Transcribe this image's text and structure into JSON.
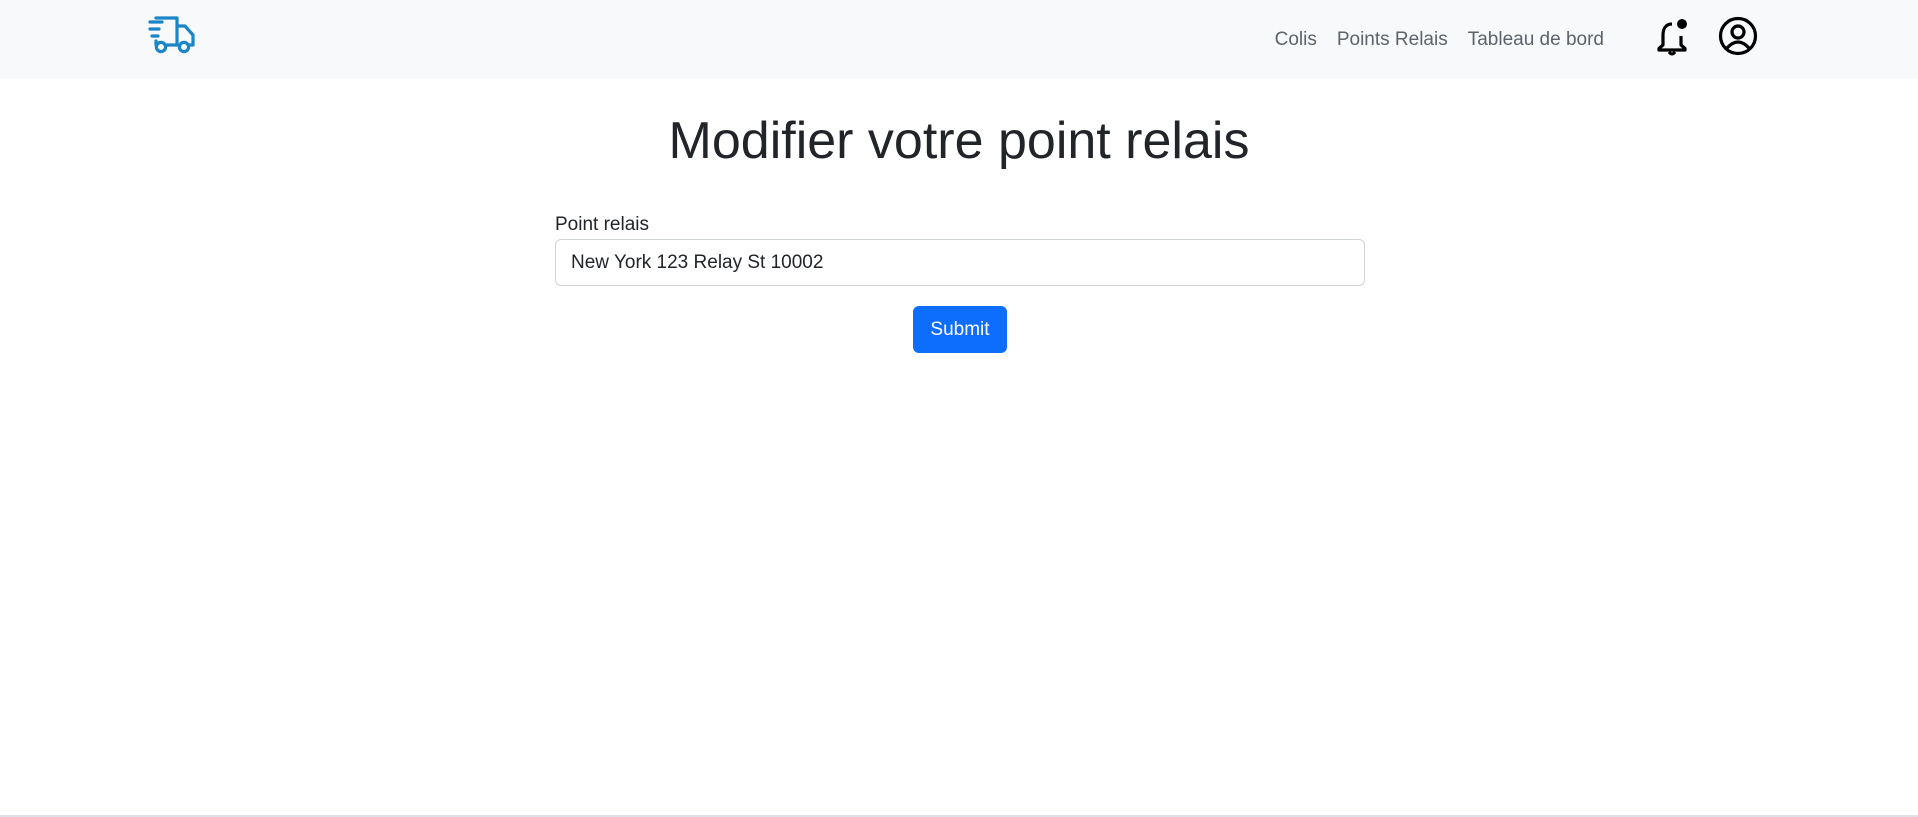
{
  "nav": {
    "logo_icon": "delivery-truck-icon",
    "links": [
      {
        "label": "Colis"
      },
      {
        "label": "Points Relais"
      },
      {
        "label": "Tableau de bord"
      }
    ],
    "notification_icon": "bell-notification-icon",
    "account_icon": "user-circle-icon"
  },
  "main": {
    "title": "Modifier votre point relais",
    "relay_field": {
      "label": "Point relais",
      "value": "New York 123 Relay St 10002"
    },
    "submit_label": "Submit"
  },
  "colors": {
    "navbar_bg": "#f8f9fa",
    "logo_blue": "#1a86c8",
    "primary": "#0d6efd",
    "text": "#212529",
    "nav_text": "#5c636a"
  }
}
